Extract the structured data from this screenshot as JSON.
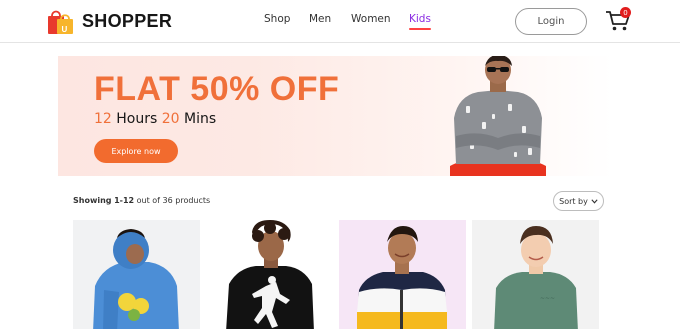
{
  "brand": {
    "name": "SHOPPER",
    "logo_icon": "shopping-bags-icon"
  },
  "nav": {
    "items": [
      {
        "label": "Shop"
      },
      {
        "label": "Men"
      },
      {
        "label": "Women"
      },
      {
        "label": "Kids",
        "active": true
      }
    ],
    "active_color": "#ff4141"
  },
  "header": {
    "login_label": "Login",
    "cart_icon": "shopping-cart-icon",
    "cart_count": "0"
  },
  "hero": {
    "headline": "FLAT 50% OFF",
    "hours": "12",
    "hours_label": "Hours",
    "mins": "20",
    "mins_label": "Mins",
    "cta_label": "Explore now",
    "accent_color": "#f26b2e"
  },
  "listing": {
    "showing_prefix": "Showing",
    "range": "1-12",
    "showing_suffix": "out of 36 products",
    "sort_label": "Sort by"
  },
  "products": [
    {
      "image": "kid in blue hoodie with fruit print"
    },
    {
      "image": "kid in black hoodie with white figure print"
    },
    {
      "image": "kid in color-block puffer jacket"
    },
    {
      "image": "kid in green sweatshirt"
    }
  ]
}
